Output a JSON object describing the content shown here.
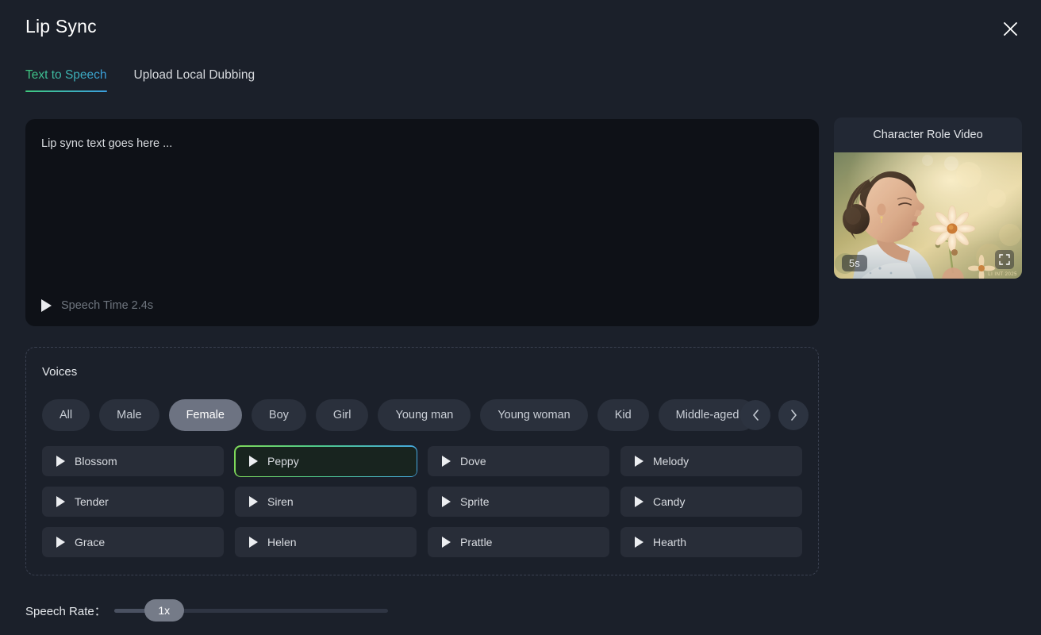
{
  "header": {
    "title": "Lip Sync",
    "close_label": "×"
  },
  "tabs": [
    {
      "label": "Text to Speech",
      "active": true
    },
    {
      "label": "Upload Local Dubbing",
      "active": false
    }
  ],
  "editor": {
    "text_value": "Lip sync text goes here ...",
    "placeholder": "Lip sync text goes here ...",
    "speech_time": "Speech Time 2.4s",
    "play_icon": "play-icon"
  },
  "role_video": {
    "title": "Character Role Video",
    "duration_badge": "5s",
    "expand_icon": "expand-icon",
    "watermark": "LI INT 2025"
  },
  "voices": {
    "label": "Voices",
    "filters": [
      {
        "label": "All",
        "selected": false
      },
      {
        "label": "Male",
        "selected": false
      },
      {
        "label": "Female",
        "selected": true
      },
      {
        "label": "Boy",
        "selected": false
      },
      {
        "label": "Girl",
        "selected": false
      },
      {
        "label": "Young man",
        "selected": false
      },
      {
        "label": "Young woman",
        "selected": false
      },
      {
        "label": "Kid",
        "selected": false
      },
      {
        "label": "Middle-aged",
        "selected": false
      }
    ],
    "nav_prev_icon": "chevron-left-icon",
    "nav_next_icon": "chevron-right-icon",
    "items": [
      {
        "name": "Blossom",
        "selected": false
      },
      {
        "name": "Peppy",
        "selected": true
      },
      {
        "name": "Dove",
        "selected": false
      },
      {
        "name": "Melody",
        "selected": false
      },
      {
        "name": "Tender",
        "selected": false
      },
      {
        "name": "Siren",
        "selected": false
      },
      {
        "name": "Sprite",
        "selected": false
      },
      {
        "name": "Candy",
        "selected": false
      },
      {
        "name": "Grace",
        "selected": false
      },
      {
        "name": "Helen",
        "selected": false
      },
      {
        "name": "Prattle",
        "selected": false
      },
      {
        "name": "Hearth",
        "selected": false
      }
    ]
  },
  "speech_rate": {
    "label": "Speech Rate：",
    "value": "1x",
    "min": "0.5x",
    "max": "2x",
    "percent": 12
  },
  "colors": {
    "page_bg": "#1b202a",
    "editor_bg": "#0e1117",
    "accent_start": "#3fca7f",
    "accent_end": "#3b9fe0",
    "chip_bg": "#2a303c",
    "chip_selected_bg": "#6d7382",
    "voice_bg": "#282d38",
    "voice_selected_bg": "#18241f"
  }
}
